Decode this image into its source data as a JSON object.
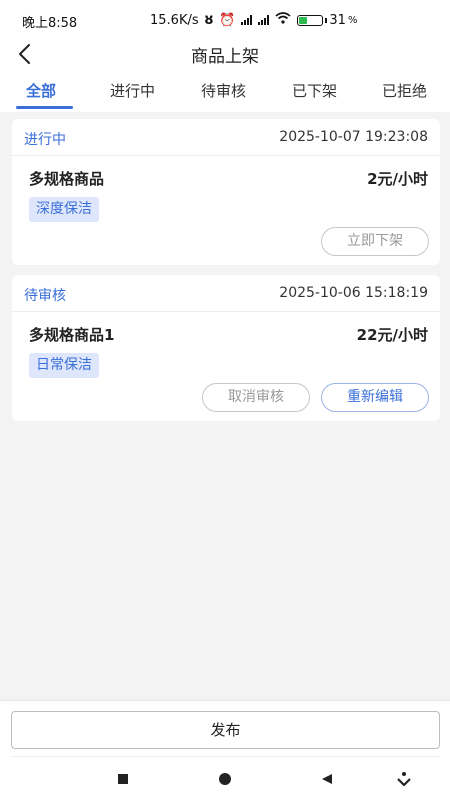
{
  "status_bar": {
    "time": "晚上8:58",
    "speed": "15.6K/s",
    "battery": "31"
  },
  "nav": {
    "title": "商品上架",
    "back_icon": "chevron-left-icon"
  },
  "tabs": [
    {
      "label": "全部",
      "active": true
    },
    {
      "label": "进行中",
      "active": false
    },
    {
      "label": "待审核",
      "active": false
    },
    {
      "label": "已下架",
      "active": false
    },
    {
      "label": "已拒绝",
      "active": false
    }
  ],
  "cards": [
    {
      "status": "进行中",
      "timestamp": "2025-10-07 19:23:08",
      "name": "多规格商品",
      "price": "2元/小时",
      "tag": "深度保洁",
      "buttons": [
        "立即下架"
      ]
    },
    {
      "status": "待审核",
      "timestamp": "2025-10-06 15:18:19",
      "name": "多规格商品1",
      "price": "22元/小时",
      "tag": "日常保洁",
      "buttons": [
        "取消审核",
        "重新编辑"
      ]
    }
  ],
  "footer": {
    "publish_label": "发布"
  },
  "colors": {
    "accent": "#3b6fd8",
    "tag_bg": "#dde6fb",
    "background": "#f3f3f3"
  }
}
